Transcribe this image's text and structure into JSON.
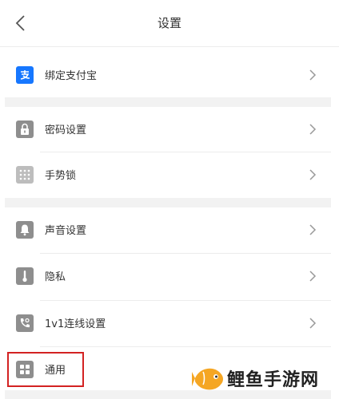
{
  "header": {
    "title": "设置"
  },
  "sections": {
    "alipay": {
      "label": "绑定支付宝",
      "icon": "alipay-icon"
    },
    "password": {
      "label": "密码设置",
      "icon": "lock-icon"
    },
    "gesture": {
      "label": "手势锁",
      "icon": "gesture-grid-icon"
    },
    "sound": {
      "label": "声音设置",
      "icon": "bell-icon"
    },
    "privacy": {
      "label": "隐私",
      "icon": "thermometer-icon"
    },
    "call": {
      "label": "1v1连线设置",
      "icon": "phone-call-icon"
    },
    "general": {
      "label": "通用",
      "icon": "grid-icon"
    }
  },
  "watermark": {
    "text": "鲤鱼手游网"
  },
  "colors": {
    "alipay": "#1677ff",
    "highlight": "#d32222",
    "watermark_fish": "#f5a623"
  }
}
